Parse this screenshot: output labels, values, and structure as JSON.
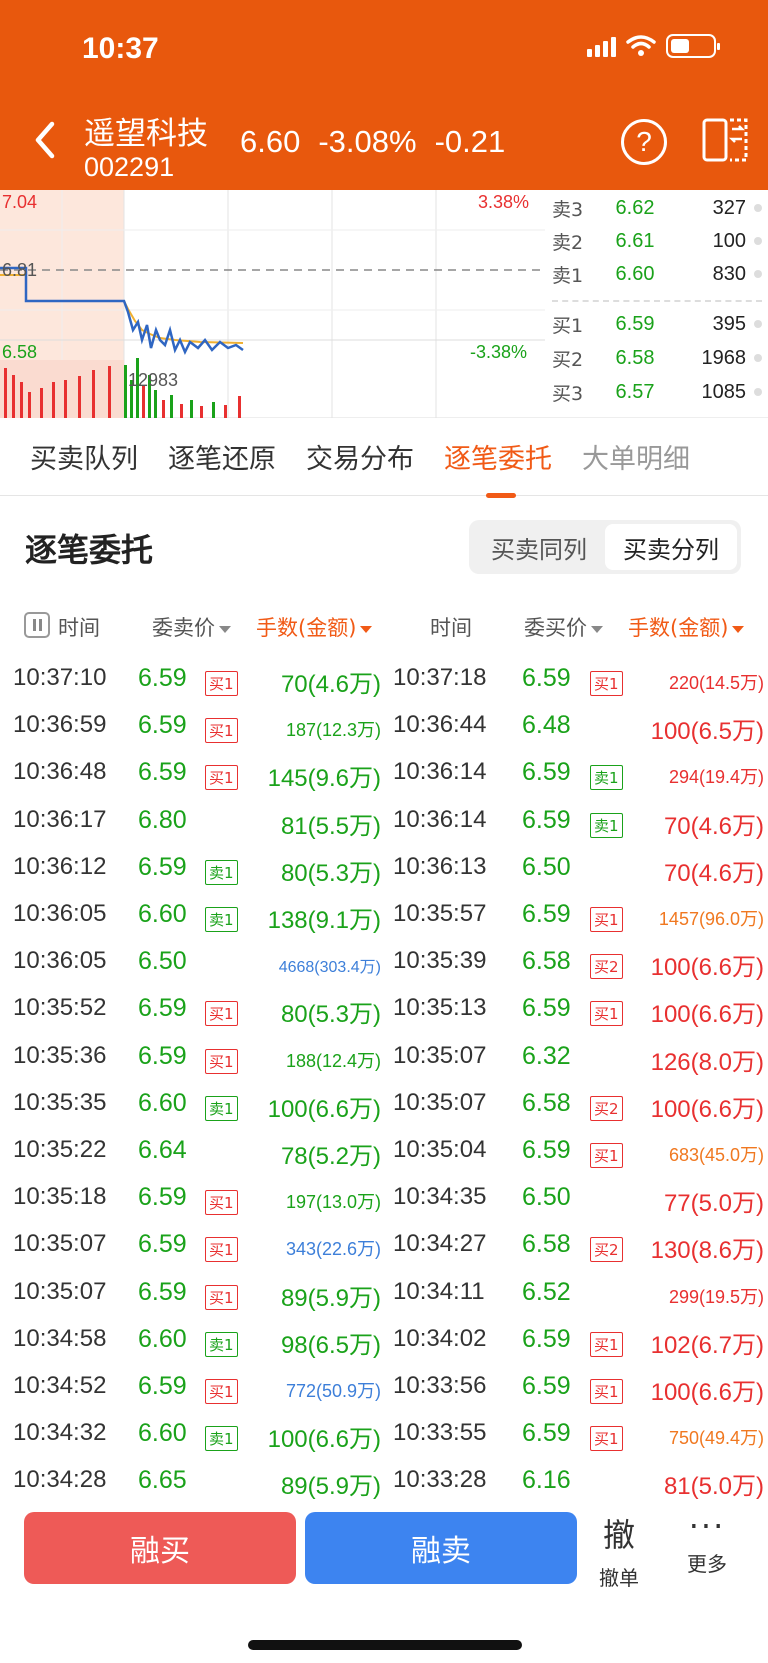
{
  "status_bar": {
    "time": "10:37"
  },
  "header": {
    "stock_name": "遥望科技",
    "stock_code": "002291",
    "price": "6.60",
    "change_pct": "-3.08%",
    "change": "-0.21",
    "help_label": "?"
  },
  "chart": {
    "high_label": "7.04",
    "high_pct": "3.38%",
    "prev_close_label": "6.81",
    "low_label": "6.58",
    "low_pct": "-3.38%",
    "volume_label": "12983"
  },
  "order_book": {
    "asks": [
      {
        "label": "卖3",
        "price": "6.62",
        "volume": "327"
      },
      {
        "label": "卖2",
        "price": "6.61",
        "volume": "100"
      },
      {
        "label": "卖1",
        "price": "6.60",
        "volume": "830"
      }
    ],
    "bids": [
      {
        "label": "买1",
        "price": "6.59",
        "volume": "395"
      },
      {
        "label": "买2",
        "price": "6.58",
        "volume": "1968"
      },
      {
        "label": "买3",
        "price": "6.57",
        "volume": "1085"
      }
    ]
  },
  "tabs": [
    "买卖队列",
    "逐笔还原",
    "交易分布",
    "逐笔委托",
    "大单明细"
  ],
  "section": {
    "title": "逐笔委托",
    "toggle": [
      "买卖同列",
      "买卖分列"
    ]
  },
  "columns": {
    "time": "时间",
    "sell_price": "委卖价",
    "volume_left": "手数(金额)",
    "time_right": "时间",
    "buy_price": "委买价",
    "volume_right": "手数(金额)"
  },
  "rows": [
    {
      "lt": "10:37:10",
      "lp": "6.59",
      "ltag": "买1",
      "lv": "70(4.6万)",
      "rt": "10:37:18",
      "rp": "6.59",
      "rtag": "买1",
      "rv": "220(14.5万)"
    },
    {
      "lt": "10:36:59",
      "lp": "6.59",
      "ltag": "买1",
      "lv": "187(12.3万)",
      "rt": "10:36:44",
      "rp": "6.48",
      "rtag": "",
      "rv": "100(6.5万)"
    },
    {
      "lt": "10:36:48",
      "lp": "6.59",
      "ltag": "买1",
      "lv": "145(9.6万)",
      "rt": "10:36:14",
      "rp": "6.59",
      "rtag": "卖1",
      "rv": "294(19.4万)"
    },
    {
      "lt": "10:36:17",
      "lp": "6.80",
      "ltag": "",
      "lv": "81(5.5万)",
      "rt": "10:36:14",
      "rp": "6.59",
      "rtag": "卖1",
      "rv": "70(4.6万)"
    },
    {
      "lt": "10:36:12",
      "lp": "6.59",
      "ltag": "卖1",
      "lv": "80(5.3万)",
      "rt": "10:36:13",
      "rp": "6.50",
      "rtag": "",
      "rv": "70(4.6万)"
    },
    {
      "lt": "10:36:05",
      "lp": "6.60",
      "ltag": "卖1",
      "lv": "138(9.1万)",
      "rt": "10:35:57",
      "rp": "6.59",
      "rtag": "买1",
      "rv": "1457(96.0万)"
    },
    {
      "lt": "10:36:05",
      "lp": "6.50",
      "ltag": "",
      "lv": "4668(303.4万)",
      "rt": "10:35:39",
      "rp": "6.58",
      "rtag": "买2",
      "rv": "100(6.6万)"
    },
    {
      "lt": "10:35:52",
      "lp": "6.59",
      "ltag": "买1",
      "lv": "80(5.3万)",
      "rt": "10:35:13",
      "rp": "6.59",
      "rtag": "买1",
      "rv": "100(6.6万)"
    },
    {
      "lt": "10:35:36",
      "lp": "6.59",
      "ltag": "买1",
      "lv": "188(12.4万)",
      "rt": "10:35:07",
      "rp": "6.32",
      "rtag": "",
      "rv": "126(8.0万)"
    },
    {
      "lt": "10:35:35",
      "lp": "6.60",
      "ltag": "卖1",
      "lv": "100(6.6万)",
      "rt": "10:35:07",
      "rp": "6.58",
      "rtag": "买2",
      "rv": "100(6.6万)"
    },
    {
      "lt": "10:35:22",
      "lp": "6.64",
      "ltag": "",
      "lv": "78(5.2万)",
      "rt": "10:35:04",
      "rp": "6.59",
      "rtag": "买1",
      "rv": "683(45.0万)"
    },
    {
      "lt": "10:35:18",
      "lp": "6.59",
      "ltag": "买1",
      "lv": "197(13.0万)",
      "rt": "10:34:35",
      "rp": "6.50",
      "rtag": "",
      "rv": "77(5.0万)"
    },
    {
      "lt": "10:35:07",
      "lp": "6.59",
      "ltag": "买1",
      "lv": "343(22.6万)",
      "rt": "10:34:27",
      "rp": "6.58",
      "rtag": "买2",
      "rv": "130(8.6万)"
    },
    {
      "lt": "10:35:07",
      "lp": "6.59",
      "ltag": "买1",
      "lv": "89(5.9万)",
      "rt": "10:34:11",
      "rp": "6.52",
      "rtag": "",
      "rv": "299(19.5万)"
    },
    {
      "lt": "10:34:58",
      "lp": "6.60",
      "ltag": "卖1",
      "lv": "98(6.5万)",
      "rt": "10:34:02",
      "rp": "6.59",
      "rtag": "买1",
      "rv": "102(6.7万)"
    },
    {
      "lt": "10:34:52",
      "lp": "6.59",
      "ltag": "买1",
      "lv": "772(50.9万)",
      "rt": "10:33:56",
      "rp": "6.59",
      "rtag": "买1",
      "rv": "100(6.6万)"
    },
    {
      "lt": "10:34:32",
      "lp": "6.60",
      "ltag": "卖1",
      "lv": "100(6.6万)",
      "rt": "10:33:55",
      "rp": "6.59",
      "rtag": "买1",
      "rv": "750(49.4万)"
    },
    {
      "lt": "10:34:28",
      "lp": "6.65",
      "ltag": "",
      "lv": "89(5.9万)",
      "rt": "10:33:28",
      "rp": "6.16",
      "rtag": "",
      "rv": "81(5.0万)"
    }
  ],
  "bottom_bar": {
    "buy": "融买",
    "sell": "融卖",
    "cancel_icon": "撤",
    "cancel_label": "撤单",
    "more_icon": "···",
    "more_label": "更多"
  },
  "colors": {
    "header_bg": "#e8580d",
    "up": "#e83030",
    "down": "#1aa21a",
    "large_blue": "#3d7fd9",
    "large_orange": "#f07820",
    "accent": "#f15a16"
  }
}
